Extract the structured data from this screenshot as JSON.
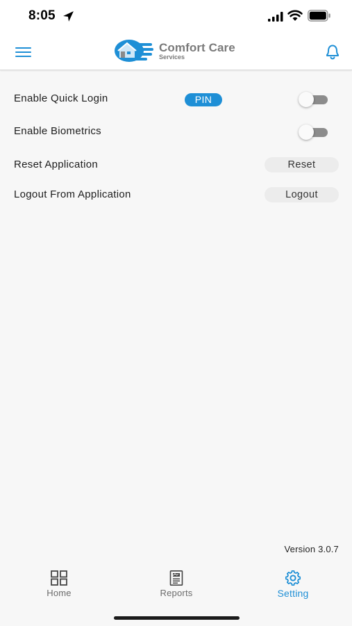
{
  "status_bar": {
    "time": "8:05",
    "icons": [
      "location-arrow-icon",
      "signal-icon",
      "wifi-icon",
      "battery-icon"
    ]
  },
  "header": {
    "logo_title": "Comfort Care",
    "logo_subtitle": "Services",
    "icons": [
      "menu-icon",
      "bell-icon"
    ]
  },
  "settings": {
    "quick_login": {
      "label": "Enable Quick Login",
      "badge": "PIN",
      "enabled": false
    },
    "biometrics": {
      "label": "Enable Biometrics",
      "enabled": false
    },
    "reset": {
      "label": "Reset Application",
      "button": "Reset"
    },
    "logout": {
      "label": "Logout From Application",
      "button": "Logout"
    }
  },
  "version": "Version 3.0.7",
  "tabs": [
    {
      "label": "Home",
      "icon": "grid-icon",
      "active": false
    },
    {
      "label": "Reports",
      "icon": "report-icon",
      "active": false
    },
    {
      "label": "Setting",
      "icon": "gear-icon",
      "active": true
    }
  ],
  "colors": {
    "accent": "#1e8fd6",
    "toggle_off": "#8c8c8c",
    "background": "#f7f7f7"
  }
}
